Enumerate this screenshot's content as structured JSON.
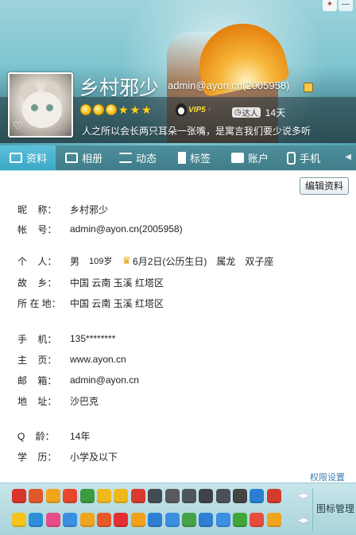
{
  "window": {
    "pin_icon": "pin-icon",
    "minimize_label": "—"
  },
  "profile": {
    "nickname": "乡村邪少",
    "account": "admin@ayon.cn(2005958)",
    "vip": "VIP5",
    "vip_arrow": "↑",
    "daren_label": "达人",
    "daren_days": "14天",
    "signature": "人之所以会长两只耳朵一张嘴，是寓言我们要少说多听",
    "level_icons": [
      "sun",
      "sun",
      "sun",
      "star",
      "star",
      "star"
    ]
  },
  "tabs": [
    {
      "label": "资料",
      "icon": "id-card-icon",
      "active": true
    },
    {
      "label": "相册",
      "icon": "photo-icon"
    },
    {
      "label": "动态",
      "icon": "list-icon"
    },
    {
      "label": "标签",
      "icon": "bookmark-icon"
    },
    {
      "label": "账户",
      "icon": "wallet-icon"
    },
    {
      "label": "手机",
      "icon": "phone-icon"
    }
  ],
  "content": {
    "edit_button": "编辑资料",
    "nickname_label": "昵    称：",
    "nickname": "乡村邪少",
    "account_label": "帐    号：",
    "account": "admin@ayon.cn(2005958)",
    "personal_label": "个    人：",
    "gender": "男",
    "age": "109岁",
    "birthday": "6月2日(公历生日)",
    "zodiac": "属龙",
    "constellation": "双子座",
    "hometown_label": "故    乡：",
    "hometown": "中国 云南 玉溪 红塔区",
    "location_label": "所 在 地：",
    "location": "中国 云南 玉溪 红塔区",
    "mobile_label": "手    机：",
    "mobile": "135********",
    "homepage_label": "主    页：",
    "homepage": "www.ayon.cn",
    "email_label": "邮    箱：",
    "email": "admin@ayon.cn",
    "address_label": "地    址：",
    "address": "沙巴克",
    "qage_label": "Q    龄：",
    "qage": "14年",
    "education_label": "学    历：",
    "education": "小学及以下",
    "permission_link": "权限设置"
  },
  "iconbar": {
    "manage_label": "图标管理",
    "row1_colors": [
      "#d9342b",
      "#e0592a",
      "#f2a41c",
      "#e8452f",
      "#3a9b3f",
      "#f0b91a",
      "#f0b91a",
      "#d83a2e",
      "#444a52",
      "#5a5a5a",
      "#50555c",
      "#3f4348",
      "#4b5056",
      "#444",
      "#2a7fd1",
      "#d33b2c"
    ],
    "row2_colors": [
      "#f5c31a",
      "#2d8fd6",
      "#e84b8a",
      "#3a8fe0",
      "#f0a51d",
      "#e8592a",
      "#e43030",
      "#f2a11a",
      "#2f7fd4",
      "#3a8fe0",
      "#47a04a",
      "#2d80d2",
      "#3a8fe0",
      "#42a53a",
      "#e74c3c",
      "#f0a51d"
    ]
  }
}
